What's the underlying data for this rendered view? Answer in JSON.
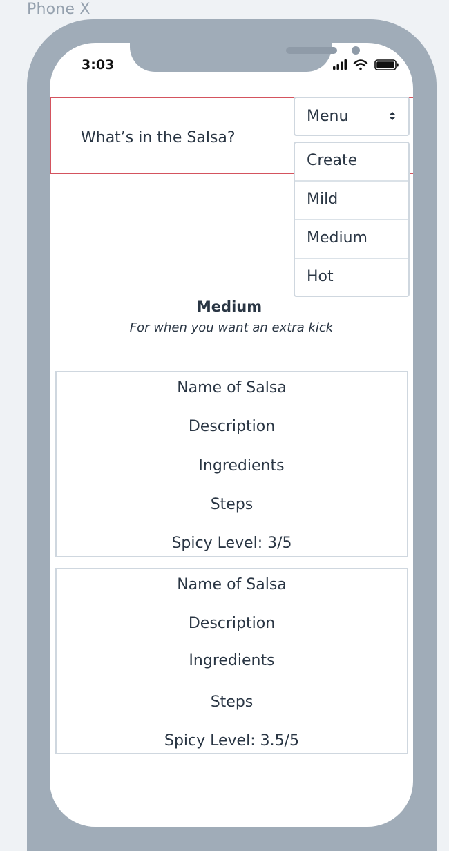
{
  "frame_label": "Phone X",
  "status_bar": {
    "time": "3:03",
    "icons": [
      "signal-icon",
      "wifi-icon",
      "battery-icon"
    ]
  },
  "header": {
    "title": "What’s in the Salsa?"
  },
  "menu": {
    "label": "Menu",
    "items": [
      "Create",
      "Mild",
      "Medium",
      "Hot"
    ]
  },
  "level": {
    "heading": "Medium",
    "tagline": "For when you want an extra kick"
  },
  "cards": [
    {
      "name": "Name of Salsa",
      "description": "Description",
      "ingredients": "Ingredients",
      "steps": "Steps",
      "spicy_level": "Spicy Level: 3/5"
    },
    {
      "name": "Name of Salsa",
      "description": "Description",
      "ingredients": "Ingredients",
      "steps": "Steps",
      "spicy_level": "Spicy Level: 3.5/5"
    }
  ],
  "colors": {
    "background": "#eff2f5",
    "phone_bezel": "#a0acb8",
    "header_border": "#d4535e",
    "text": "#2a3644",
    "card_border": "#cfd7df"
  }
}
